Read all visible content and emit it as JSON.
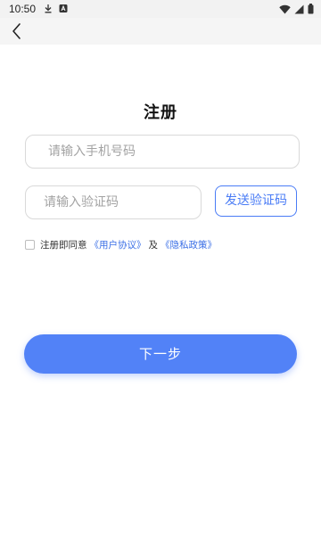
{
  "status_bar": {
    "time": "10:50",
    "left_icons": [
      "download-icon",
      "a-badge-icon"
    ],
    "right_icons": [
      "wifi-icon",
      "signal-icon",
      "battery-icon"
    ]
  },
  "app_bar": {
    "back_icon": "back-arrow-icon"
  },
  "page": {
    "title": "注册"
  },
  "form": {
    "phone_placeholder": "请输入手机号码",
    "code_placeholder": "请输入验证码",
    "send_code_label": "发送验证码",
    "agree_prefix": "注册即同意",
    "user_agreement": "《用户协议》",
    "agree_and": "及",
    "privacy_policy": "《隐私政策》",
    "next_label": "下一步"
  },
  "colors": {
    "accent": "#5282f7",
    "link": "#3b6fe6"
  }
}
